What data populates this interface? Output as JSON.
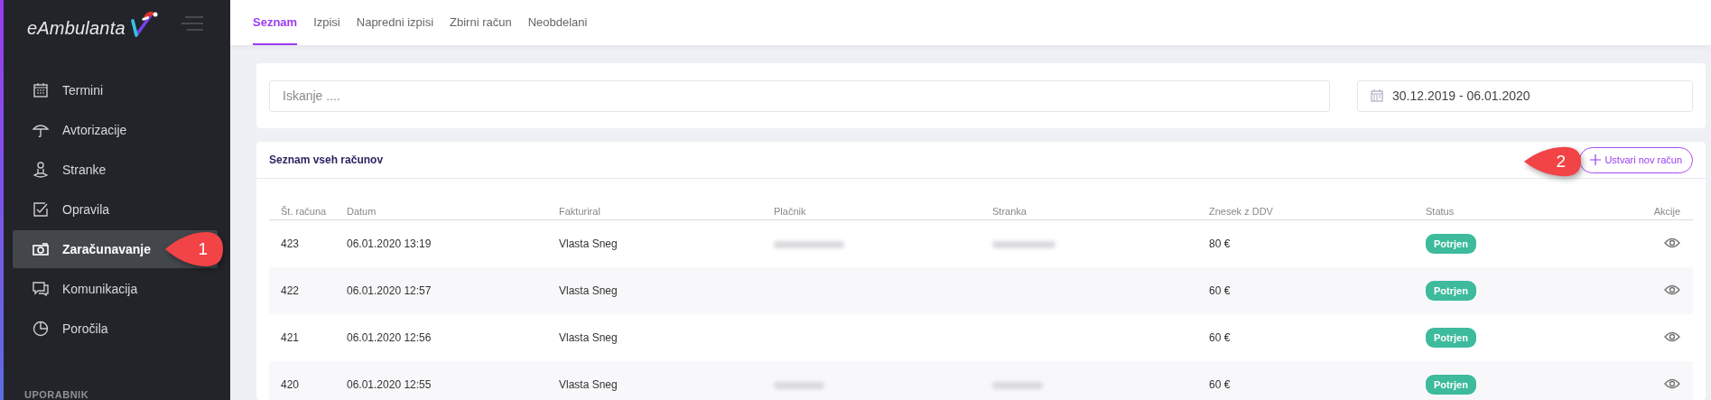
{
  "sidebar": {
    "logo": "eAmbulanta",
    "items": [
      {
        "label": "Termini",
        "selected": false
      },
      {
        "label": "Avtorizacije",
        "selected": false
      },
      {
        "label": "Stranke",
        "selected": false
      },
      {
        "label": "Opravila",
        "selected": false
      },
      {
        "label": "Zaračunavanje",
        "selected": true
      },
      {
        "label": "Komunikacija",
        "selected": false
      },
      {
        "label": "Poročila",
        "selected": false
      }
    ],
    "section_label": "UPORABNIK"
  },
  "tabs": [
    {
      "label": "Seznam",
      "selected": true
    },
    {
      "label": "Izpisi",
      "selected": false
    },
    {
      "label": "Napredni izpisi",
      "selected": false
    },
    {
      "label": "Zbirni račun",
      "selected": false
    },
    {
      "label": "Neobdelani",
      "selected": false
    }
  ],
  "search": {
    "placeholder": "Iskanje ...."
  },
  "date_range": {
    "value": "30.12.2019 - 06.01.2020"
  },
  "table_card": {
    "title": "Seznam vseh računov",
    "button": "Ustvari nov račun",
    "columns": [
      "Št. računa",
      "Datum",
      "Fakturiral",
      "Plačnik",
      "Stranka",
      "Znesek z DDV",
      "Status",
      "Akcije"
    ],
    "rows": [
      {
        "number": "423",
        "date": "06.01.2020 13:19",
        "issuer": "Vlasta Sneg",
        "payer_redacted": true,
        "client_redacted": true,
        "amount": "80 €",
        "status": "Potrjen"
      },
      {
        "number": "422",
        "date": "06.01.2020 12:57",
        "issuer": "Vlasta Sneg",
        "payer_redacted": false,
        "client_redacted": false,
        "amount": "60 €",
        "status": "Potrjen"
      },
      {
        "number": "421",
        "date": "06.01.2020 12:56",
        "issuer": "Vlasta Sneg",
        "payer_redacted": false,
        "client_redacted": false,
        "amount": "60 €",
        "status": "Potrjen"
      },
      {
        "number": "420",
        "date": "06.01.2020 12:55",
        "issuer": "Vlasta Sneg",
        "payer_redacted": true,
        "client_redacted": true,
        "amount": "60 €",
        "status": "Potrjen"
      }
    ]
  },
  "callouts": [
    {
      "label": "1"
    },
    {
      "label": "2"
    }
  ]
}
